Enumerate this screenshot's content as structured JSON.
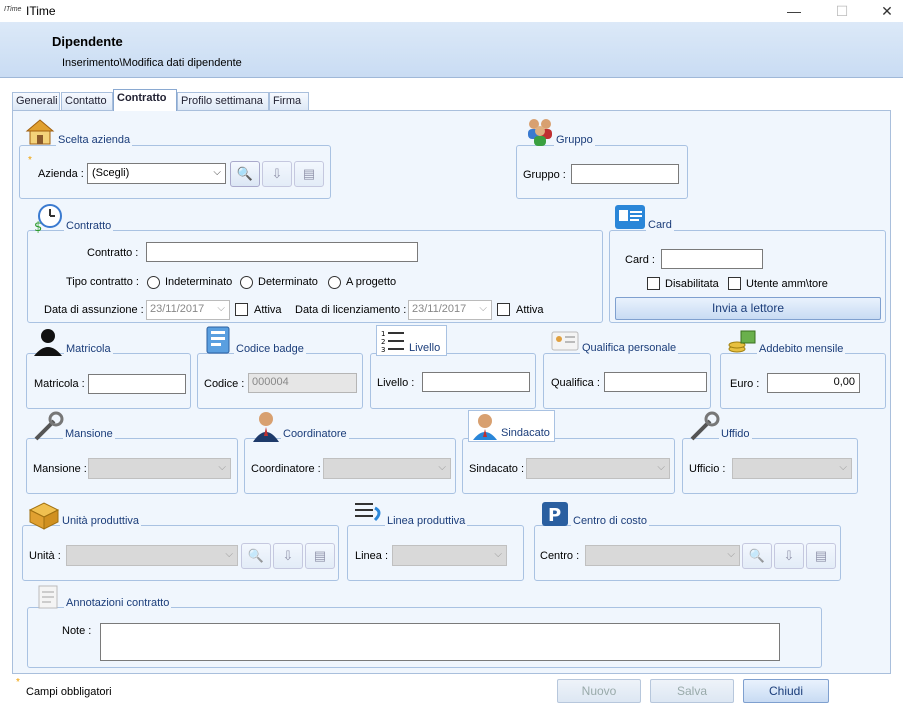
{
  "window": {
    "logo": "ITime",
    "title": "ITime",
    "minimize": "—",
    "maximize": "☐",
    "close": "✕"
  },
  "banner": {
    "title": "Dipendente",
    "subtitle": "Inserimento\\Modifica dati dipendente"
  },
  "tabs": [
    {
      "label": "Generali"
    },
    {
      "label": "Contatto"
    },
    {
      "label": "Contratto"
    },
    {
      "label": "Profilo settimana"
    },
    {
      "label": "Firma"
    }
  ],
  "azienda": {
    "group_title": "Scelta azienda",
    "label": "Azienda :",
    "value": "(Scegli)"
  },
  "gruppo": {
    "group_title": "Gruppo",
    "label": "Gruppo :",
    "value": ""
  },
  "contratto": {
    "group_title": "Contratto",
    "contratto_label": "Contratto :",
    "contratto_value": "",
    "tipo_label": "Tipo contratto :",
    "options": [
      "Indeterminato",
      "Determinato",
      "A progetto"
    ],
    "assunzione_label": "Data di assunzione :",
    "assunzione_value": "23/11/2017",
    "attiva1_label": "Attiva",
    "licenziamento_label": "Data di licenziamento :",
    "licenziamento_value": "23/11/2017",
    "attiva2_label": "Attiva"
  },
  "card": {
    "group_title": "Card",
    "label": "Card :",
    "value": "",
    "disabilitata_label": "Disabilitata",
    "utente_label": "Utente amm\\tore",
    "invia_label": "Invia a lettore"
  },
  "matricola": {
    "group_title": "Matricola",
    "label": "Matricola :",
    "value": ""
  },
  "codice_badge": {
    "group_title": "Codice badge",
    "label": "Codice :",
    "value": "000004"
  },
  "livello": {
    "group_title": "Livello",
    "label": "Livello :",
    "value": ""
  },
  "qualifica": {
    "group_title": "Qualifica personale",
    "label": "Qualifica :",
    "value": ""
  },
  "addebito": {
    "group_title": "Addebito mensile",
    "label": "Euro :",
    "value": "0,00"
  },
  "mansione": {
    "group_title": "Mansione",
    "label": "Mansione :"
  },
  "coordinatore": {
    "group_title": "Coordinatore",
    "label": "Coordinatore :"
  },
  "sindacato": {
    "group_title": "Sindacato",
    "label": "Sindacato :"
  },
  "ufficio": {
    "group_title": "Uffido",
    "label": "Ufficio :"
  },
  "unita": {
    "group_title": "Unità produttiva",
    "label": "Unità :"
  },
  "linea": {
    "group_title": "Linea produttiva",
    "label": "Linea :"
  },
  "centro": {
    "group_title": "Centro di costo",
    "label": "Centro :"
  },
  "annotazioni": {
    "group_title": "Annotazioni contratto",
    "label": "Note :",
    "value": ""
  },
  "footer": {
    "required_mark": "*",
    "required_text": "Campi obbligatori",
    "nuovo_label": "Nuovo",
    "salva_label": "Salva",
    "chiudi_label": "Chiudi"
  }
}
